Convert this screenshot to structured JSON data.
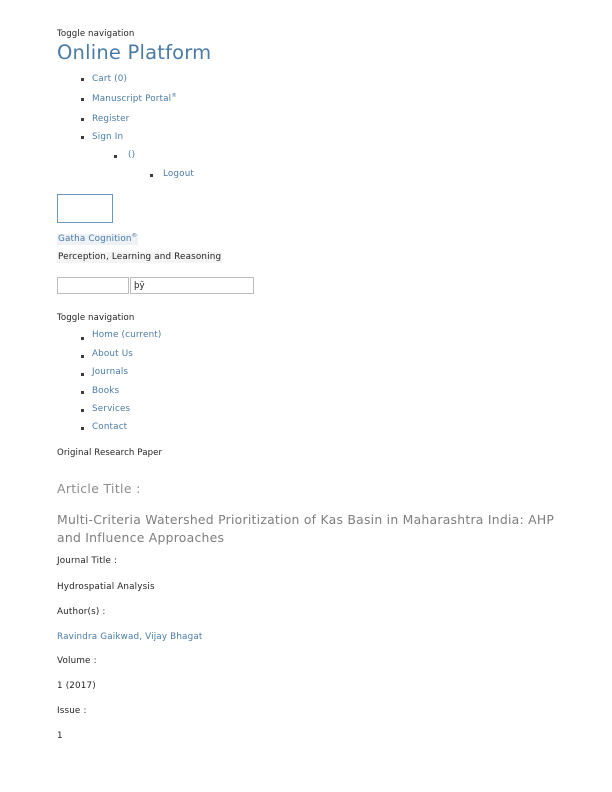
{
  "top_nav": {
    "toggle_label": "Toggle navigation",
    "brand": "Online Platform",
    "items": [
      {
        "label": "Cart (0)"
      },
      {
        "label": "Manuscript Portal",
        "sup": "®"
      },
      {
        "label": "Register"
      },
      {
        "label": "Sign In"
      }
    ],
    "sub_items": [
      {
        "label": "()"
      }
    ],
    "sub_sub_items": [
      {
        "label": "Logout"
      }
    ]
  },
  "brandbar": {
    "logo_box_alt": "logo-placeholder",
    "site_name": "Gatha Cognition",
    "site_name_sup": "®",
    "tagline": "Perception, Learning and Reasoning"
  },
  "search": {
    "left_value": "",
    "left_placeholder": "",
    "right_value": "þÿ",
    "right_placeholder": ""
  },
  "main_nav": {
    "toggle_label": "Toggle navigation",
    "items": [
      {
        "label": "Home (current)"
      },
      {
        "label": "About Us"
      },
      {
        "label": "Journals"
      },
      {
        "label": "Books"
      },
      {
        "label": "Services"
      },
      {
        "label": "Contact"
      }
    ]
  },
  "article": {
    "kicker": "Original Research Paper",
    "title_label": "Article Title :",
    "title": "Multi-Criteria Watershed Prioritization of Kas Basin in Maharashtra India: AHP and Influence Approaches",
    "journal_label": "Journal Title :",
    "journal": "Hydrospatial Analysis",
    "authors_label": "Author(s) :",
    "authors": "Ravindra Gaikwad, Vijay Bhagat",
    "volume_label": "Volume :",
    "volume": "1 (2017)",
    "issue_label": "Issue :",
    "issue": "1"
  },
  "colors": {
    "link": "#4a7ba6",
    "text": "#231f20",
    "muted_title": "#7e7e7e",
    "box_border": "#6d96b8",
    "input_border": "#bcbcbc"
  }
}
